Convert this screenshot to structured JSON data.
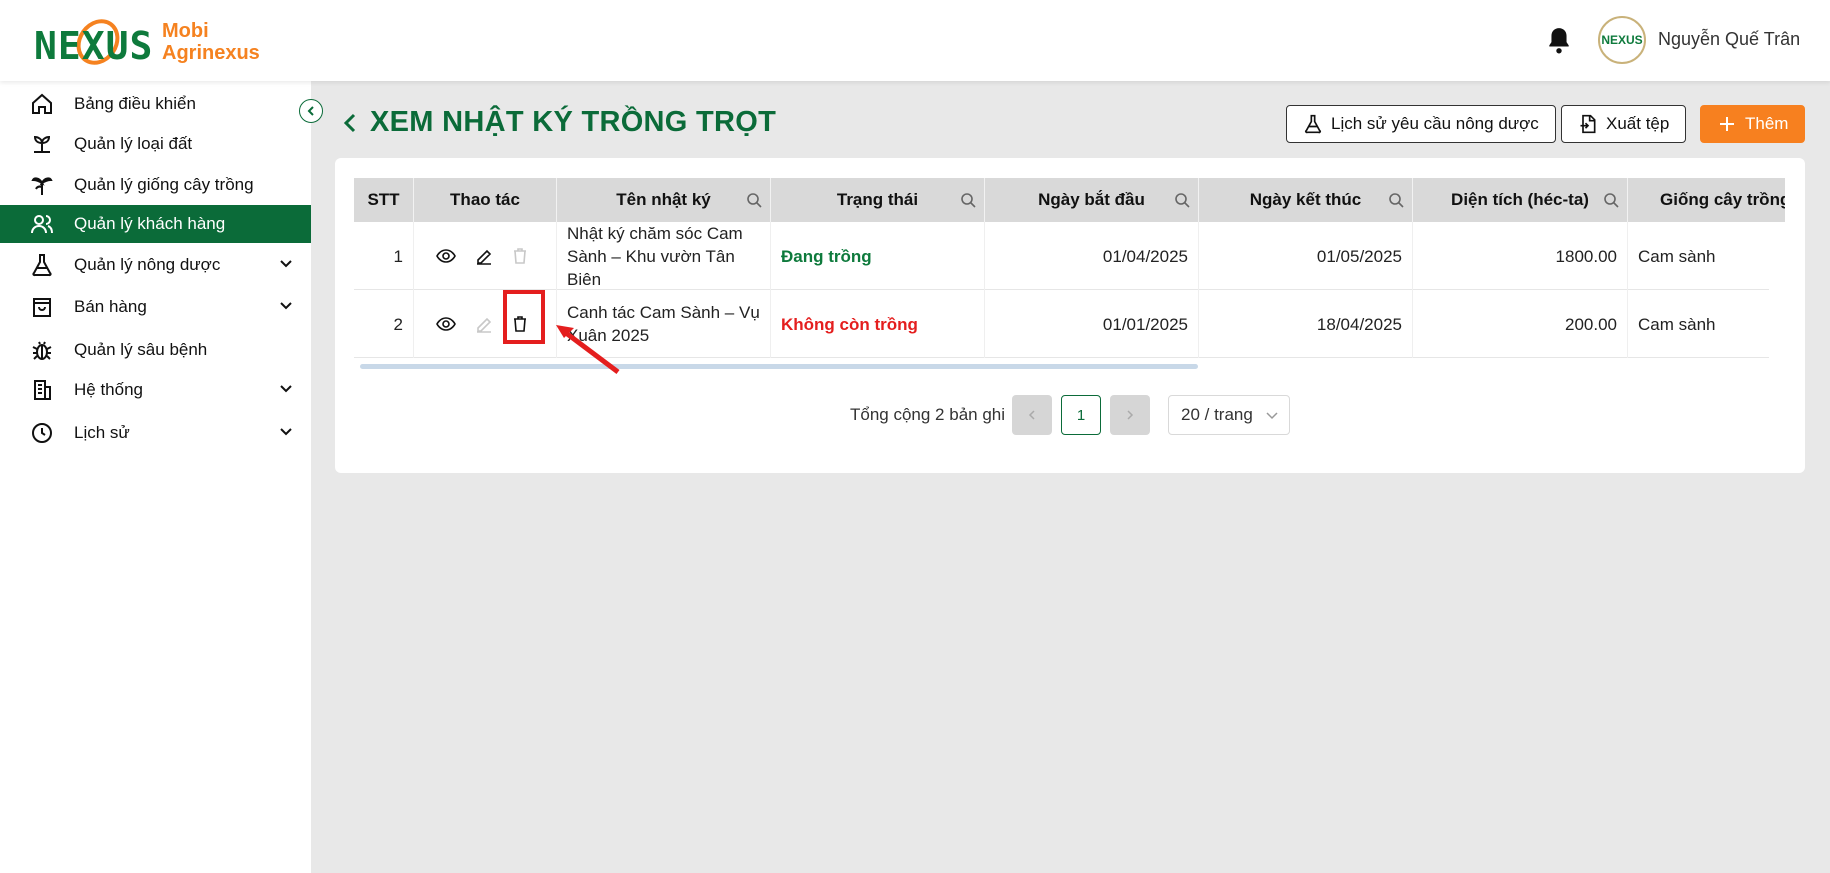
{
  "header": {
    "logo_text": "NEXUS",
    "app_name_line1": "Mobi",
    "app_name_line2": "Agrinexus",
    "avatar_text": "NEXUS",
    "user_name": "Nguyễn Quế Trân"
  },
  "sidebar": {
    "items": [
      {
        "label": "Bảng điều khiển",
        "icon": "home-icon"
      },
      {
        "label": "Quản lý loại đất",
        "icon": "soil-icon"
      },
      {
        "label": "Quản lý giống cây trồng",
        "icon": "plant-icon"
      },
      {
        "label": "Quản lý khách hàng",
        "icon": "users-icon",
        "active": true
      },
      {
        "label": "Quản lý nông dược",
        "icon": "flask-icon",
        "expandable": true
      },
      {
        "label": "Bán hàng",
        "icon": "shopping-bag-icon",
        "expandable": true
      },
      {
        "label": "Quản lý sâu bệnh",
        "icon": "bug-icon"
      },
      {
        "label": "Hệ thống",
        "icon": "building-icon",
        "expandable": true
      },
      {
        "label": "Lịch sử",
        "icon": "clock-icon",
        "expandable": true
      }
    ]
  },
  "page": {
    "title": "XEM NHẬT KÝ TRỒNG TRỌT",
    "btn_history": "Lịch sử yêu cầu nông dược",
    "btn_export": "Xuất tệp",
    "btn_add": "Thêm"
  },
  "table": {
    "columns": [
      "STT",
      "Thao tác",
      "Tên nhật ký",
      "Trạng thái",
      "Ngày bắt đầu",
      "Ngày kết thúc",
      "Diện tích (héc-ta)",
      "Giống cây trồng"
    ],
    "rows": [
      {
        "stt": "1",
        "name": "Nhật ký chăm sóc Cam Sành – Khu vườn Tân Biên",
        "status": "Đang trồng",
        "status_color": "#0e7a3c",
        "start": "01/04/2025",
        "end": "01/05/2025",
        "area": "1800.00",
        "variety": "Cam sành"
      },
      {
        "stt": "2",
        "name": "Canh tác Cam Sành – Vụ Xuân 2025",
        "status": "Không còn trồng",
        "status_color": "#e41e1e",
        "start": "01/01/2025",
        "end": "18/04/2025",
        "area": "200.00",
        "variety": "Cam sành"
      }
    ]
  },
  "pagination": {
    "total": "Tổng cộng 2 bản ghi",
    "current_page": "1",
    "page_size": "20 / trang"
  },
  "colors": {
    "primary": "#0b6b39",
    "accent": "#f7801f",
    "danger": "#e41e1e"
  }
}
